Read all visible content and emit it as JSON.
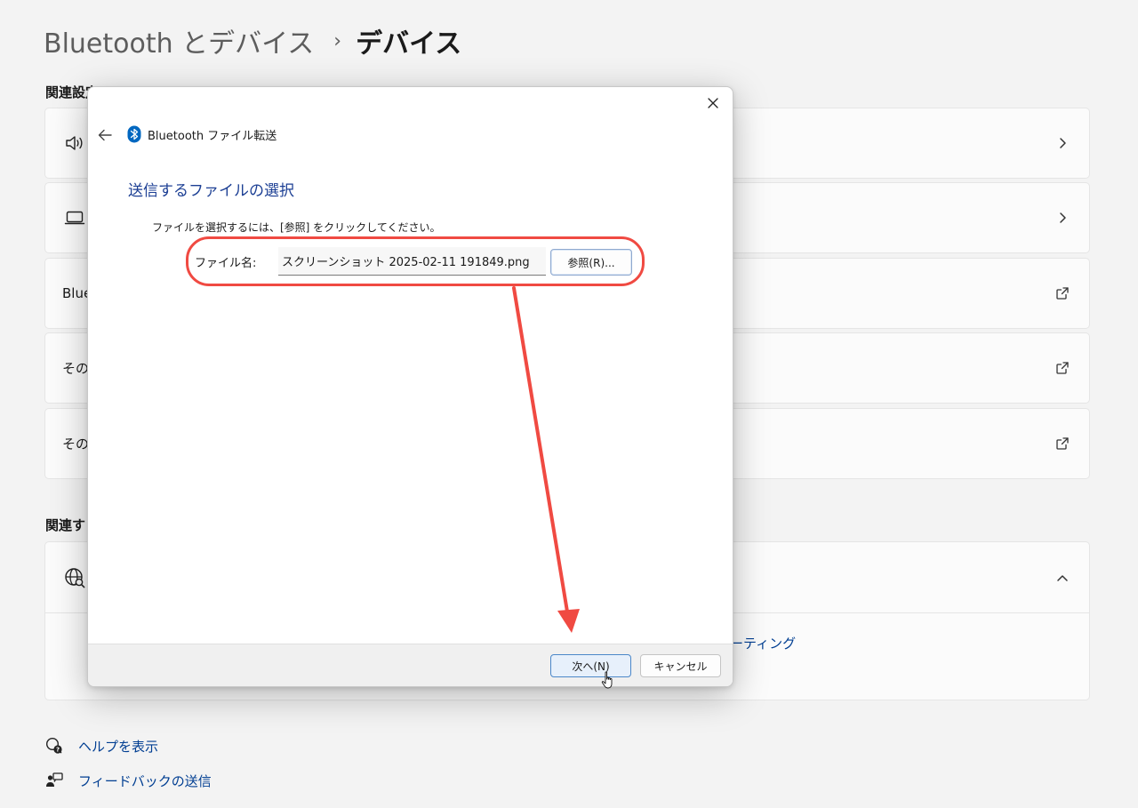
{
  "header": {
    "parent": "Bluetooth とデバイス",
    "separator": "›",
    "current": "デバイス"
  },
  "related_settings": {
    "label": "関連設定",
    "cards": [
      {
        "icon": "speaker-icon",
        "label": "",
        "right_icon": "chevron-right-icon"
      },
      {
        "icon": "laptop-icon",
        "label": "",
        "right_icon": "chevron-right-icon"
      },
      {
        "icon": "",
        "label": "Blue",
        "right_icon": "external-link-icon"
      },
      {
        "icon": "",
        "label": "その",
        "right_icon": "external-link-icon"
      },
      {
        "icon": "",
        "label": "その",
        "right_icon": "external-link-icon"
      }
    ]
  },
  "related_support": {
    "label": "関連す",
    "card_icon": "globe-search-icon",
    "right_icon": "chevron-up-icon",
    "link_text": "ーティング"
  },
  "footer": {
    "help": "ヘルプを表示",
    "feedback": "フィードバックの送信"
  },
  "dialog": {
    "title": "Bluetooth ファイル転送",
    "heading": "送信するファイルの選択",
    "instruction": "ファイルを選択するには、[参照] をクリックしてください。",
    "file_label": "ファイル名:",
    "file_value": "スクリーンショット 2025-02-11 191849.png",
    "browse_button": "参照(R)...",
    "next_button": "次へ(N)",
    "cancel_button": "キャンセル"
  },
  "colors": {
    "accent": "#003e92",
    "heading": "#1c3f94",
    "annotation": "#f04a42",
    "bluetooth": "#0067c0"
  }
}
